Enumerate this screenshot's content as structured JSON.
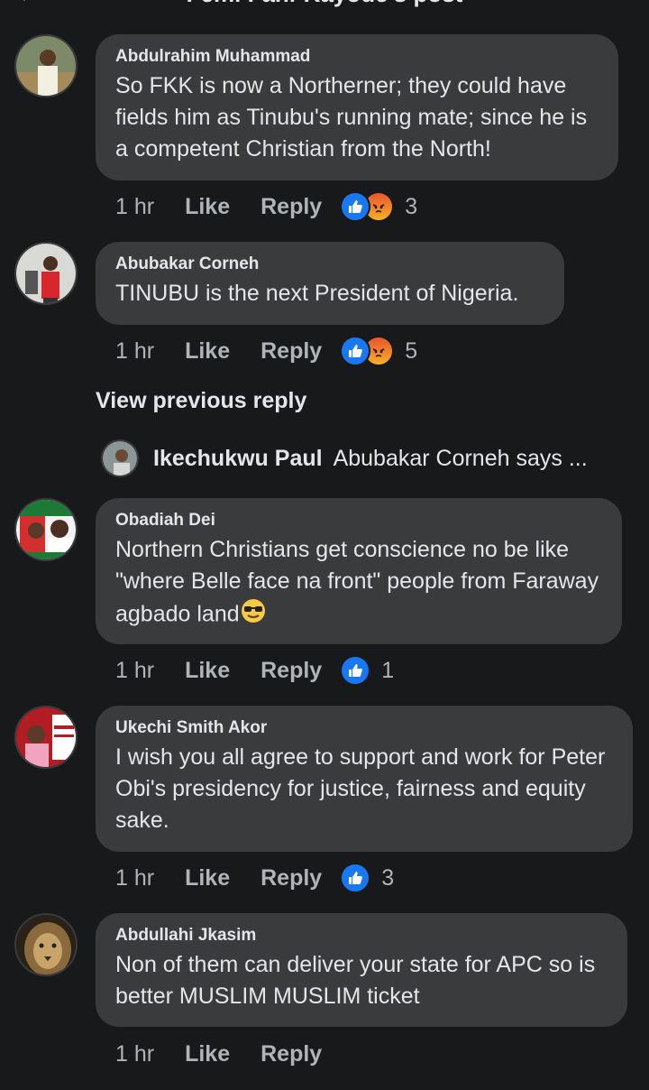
{
  "header": {
    "title": "Femi Fani-Kayode's post"
  },
  "icons": {
    "back": "back-arrow-icon",
    "like": "thumbs-up-icon",
    "angry": "angry-face-icon",
    "emoji": "sunglasses-emoji-icon"
  },
  "colors": {
    "background": "#18191a",
    "bubble": "#3a3b3c",
    "like_blue": "#1877f2",
    "angry_orange": "#e9552e"
  },
  "comments": [
    {
      "name": "Abdulrahim Muhammad",
      "text": "So FKK is now a Northerner; they could have fields him as Tinubu's running mate; since he is a competent Christian from the North!",
      "time": "1 hr",
      "like": "Like",
      "reply": "Reply",
      "reactions": "3"
    },
    {
      "name": "Abubakar Corneh",
      "text": "TINUBU is the next President of Nigeria.",
      "time": "1 hr",
      "like": "Like",
      "reply": "Reply",
      "reactions": "5"
    },
    {
      "name": "Obadiah Dei",
      "text": "Northern Christians get conscience no be like \"where Belle face na front\" people from Faraway agbado land",
      "time": "1 hr",
      "like": "Like",
      "reply": "Reply",
      "reactions": "1"
    },
    {
      "name": "Ukechi Smith Akor",
      "text": "I wish you all agree to support and work for Peter Obi's presidency for justice, fairness and equity sake.",
      "time": "1 hr",
      "like": "Like",
      "reply": "Reply",
      "reactions": "3"
    },
    {
      "name": "Abdullahi Jkasim",
      "text": "Non of them can deliver your state for APC so is better MUSLIM MUSLIM ticket",
      "time": "1 hr",
      "like": "Like",
      "reply": "Reply"
    }
  ],
  "view_previous": "View previous reply",
  "reply_preview": {
    "name": "Ikechukwu Paul",
    "text": "Abubakar Corneh says ..."
  }
}
